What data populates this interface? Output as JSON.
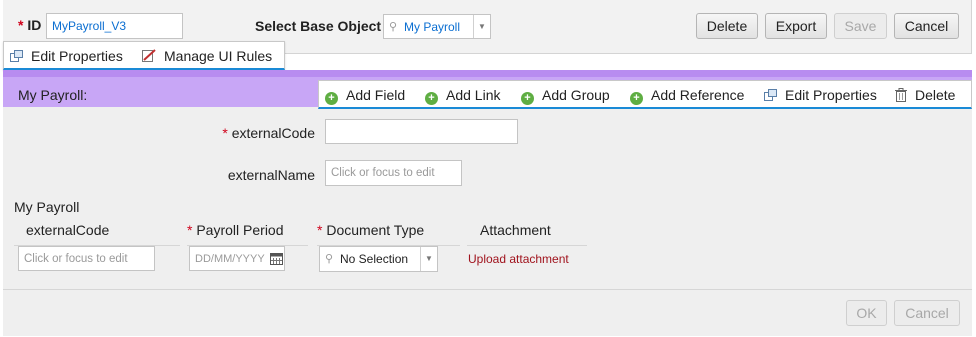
{
  "header": {
    "id_required": "*",
    "id_label": "ID",
    "id_value": "MyPayroll_V3",
    "base_object_label": "Select Base Object",
    "base_object_value": "My Payroll",
    "buttons": {
      "delete": "Delete",
      "export": "Export",
      "save": "Save",
      "cancel": "Cancel"
    }
  },
  "popup_menu": {
    "edit_properties": "Edit Properties",
    "manage_ui_rules": "Manage UI Rules"
  },
  "section": {
    "title": "My Payroll:",
    "toolbar": {
      "add_field": "Add Field",
      "add_link": "Add Link",
      "add_group": "Add Group",
      "add_reference": "Add Reference",
      "edit_properties": "Edit Properties",
      "delete": "Delete"
    }
  },
  "form": {
    "external_code_required": "*",
    "external_code_label": "externalCode",
    "external_code_value": "",
    "external_name_label": "externalName",
    "external_name_placeholder": "Click or focus to edit"
  },
  "subgrid": {
    "title": "My Payroll",
    "columns": {
      "external_code": "externalCode",
      "payroll_period_required": "*",
      "payroll_period": "Payroll Period",
      "document_type_required": "*",
      "document_type": "Document Type",
      "attachment": "Attachment"
    },
    "row": {
      "external_code_placeholder": "Click or focus to edit",
      "payroll_period_placeholder": "DD/MM/YYYY",
      "document_type_value": "No Selection",
      "attachment_link": "Upload attachment"
    }
  },
  "footer": {
    "ok": "OK",
    "cancel": "Cancel"
  },
  "colors": {
    "section_header": "#c8a6f6",
    "accent_blue": "#1a8ad6",
    "required_red": "#d0021b",
    "link_red": "#a0131d"
  }
}
